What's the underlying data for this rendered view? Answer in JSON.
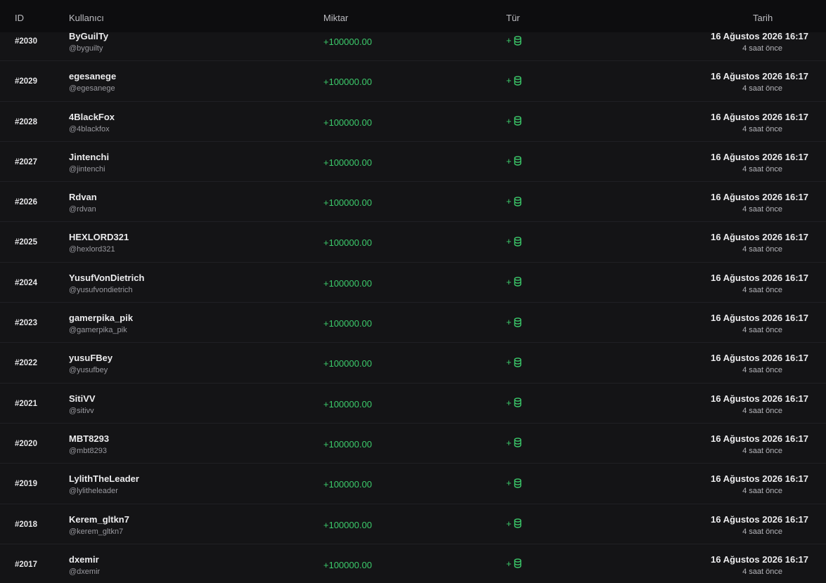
{
  "header": {
    "id": "ID",
    "user": "Kullanıcı",
    "amount": "Miktar",
    "type": "Tür",
    "date": "Tarih"
  },
  "colors": {
    "background": "#141416",
    "header_bg": "#0d0d0f",
    "positive": "#3ccb6b",
    "muted": "#9a9aa0"
  },
  "rows": [
    {
      "id": "#2030",
      "name": "ByGuilTy",
      "handle": "@byguilty",
      "amount": "+100000.00",
      "sign": "+",
      "icon": "coins-icon",
      "date": "16 Ağustos 2026 16:17",
      "ago": "4 saat önce"
    },
    {
      "id": "#2029",
      "name": "egesanege",
      "handle": "@egesanege",
      "amount": "+100000.00",
      "sign": "+",
      "icon": "coins-icon",
      "date": "16 Ağustos 2026 16:17",
      "ago": "4 saat önce"
    },
    {
      "id": "#2028",
      "name": "4BlackFox",
      "handle": "@4blackfox",
      "amount": "+100000.00",
      "sign": "+",
      "icon": "coins-icon",
      "date": "16 Ağustos 2026 16:17",
      "ago": "4 saat önce"
    },
    {
      "id": "#2027",
      "name": "Jintenchi",
      "handle": "@jintenchi",
      "amount": "+100000.00",
      "sign": "+",
      "icon": "coins-icon",
      "date": "16 Ağustos 2026 16:17",
      "ago": "4 saat önce"
    },
    {
      "id": "#2026",
      "name": "Rdvan",
      "handle": "@rdvan",
      "amount": "+100000.00",
      "sign": "+",
      "icon": "coins-icon",
      "date": "16 Ağustos 2026 16:17",
      "ago": "4 saat önce"
    },
    {
      "id": "#2025",
      "name": "HEXLORD321",
      "handle": "@hexlord321",
      "amount": "+100000.00",
      "sign": "+",
      "icon": "coins-icon",
      "date": "16 Ağustos 2026 16:17",
      "ago": "4 saat önce"
    },
    {
      "id": "#2024",
      "name": "YusufVonDietrich",
      "handle": "@yusufvondietrich",
      "amount": "+100000.00",
      "sign": "+",
      "icon": "coins-icon",
      "date": "16 Ağustos 2026 16:17",
      "ago": "4 saat önce"
    },
    {
      "id": "#2023",
      "name": "gamerpika_pik",
      "handle": "@gamerpika_pik",
      "amount": "+100000.00",
      "sign": "+",
      "icon": "coins-icon",
      "date": "16 Ağustos 2026 16:17",
      "ago": "4 saat önce"
    },
    {
      "id": "#2022",
      "name": "yusuFBey",
      "handle": "@yusufbey",
      "amount": "+100000.00",
      "sign": "+",
      "icon": "coins-icon",
      "date": "16 Ağustos 2026 16:17",
      "ago": "4 saat önce"
    },
    {
      "id": "#2021",
      "name": "SitiVV",
      "handle": "@sitivv",
      "amount": "+100000.00",
      "sign": "+",
      "icon": "coins-icon",
      "date": "16 Ağustos 2026 16:17",
      "ago": "4 saat önce"
    },
    {
      "id": "#2020",
      "name": "MBT8293",
      "handle": "@mbt8293",
      "amount": "+100000.00",
      "sign": "+",
      "icon": "coins-icon",
      "date": "16 Ağustos 2026 16:17",
      "ago": "4 saat önce"
    },
    {
      "id": "#2019",
      "name": "LylithTheLeader",
      "handle": "@lylitheleader",
      "amount": "+100000.00",
      "sign": "+",
      "icon": "coins-icon",
      "date": "16 Ağustos 2026 16:17",
      "ago": "4 saat önce"
    },
    {
      "id": "#2018",
      "name": "Kerem_gltkn7",
      "handle": "@kerem_gltkn7",
      "amount": "+100000.00",
      "sign": "+",
      "icon": "coins-icon",
      "date": "16 Ağustos 2026 16:17",
      "ago": "4 saat önce"
    },
    {
      "id": "#2017",
      "name": "dxemir",
      "handle": "@dxemir",
      "amount": "+100000.00",
      "sign": "+",
      "icon": "coins-icon",
      "date": "16 Ağustos 2026 16:17",
      "ago": "4 saat önce"
    }
  ]
}
